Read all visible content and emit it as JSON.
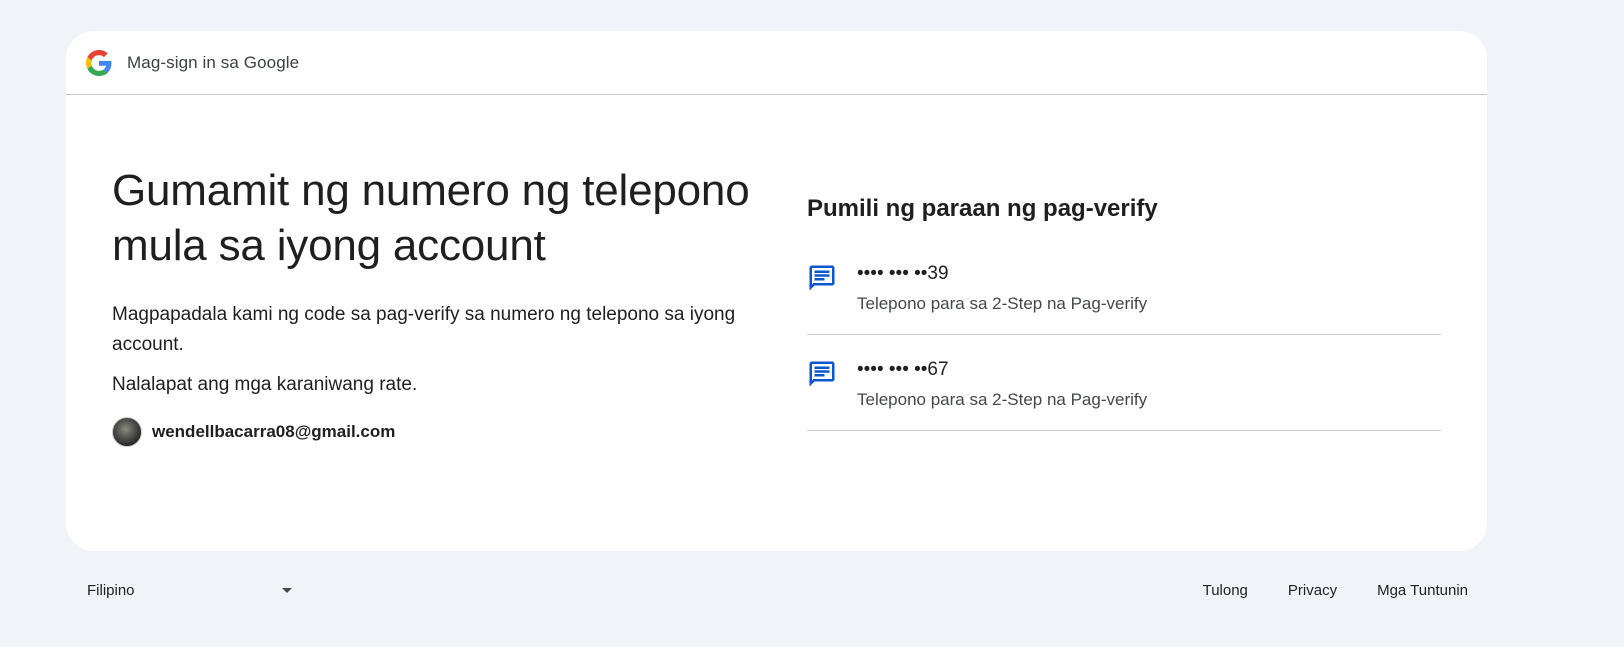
{
  "header": {
    "title": "Mag-sign in sa Google",
    "logo_icon": "google-g-logo"
  },
  "main": {
    "title": "Gumamit ng numero ng telepono mula sa iyong account",
    "description": "Magpapadala kami ng code sa pag-verify sa numero ng telepono sa iyong account.",
    "rates_note": "Nalalapat ang mga karaniwang rate.",
    "account_email": "wendellbacarra08@gmail.com"
  },
  "verify": {
    "title": "Pumili ng paraan ng pag-verify",
    "options": [
      {
        "number": "•••• ••• ••39",
        "subtitle": "Telepono para sa 2-Step na Pag-verify",
        "icon": "message-icon"
      },
      {
        "number": "•••• ••• ••67",
        "subtitle": "Telepono para sa 2-Step na Pag-verify",
        "icon": "message-icon"
      }
    ]
  },
  "footer": {
    "language": "Filipino",
    "links": [
      "Tulong",
      "Privacy",
      "Mga Tuntunin"
    ]
  },
  "colors": {
    "page_bg": "#f0f4f9",
    "card_bg": "#ffffff",
    "icon_blue": "#0b57d0",
    "divider": "#c4c7c5"
  }
}
